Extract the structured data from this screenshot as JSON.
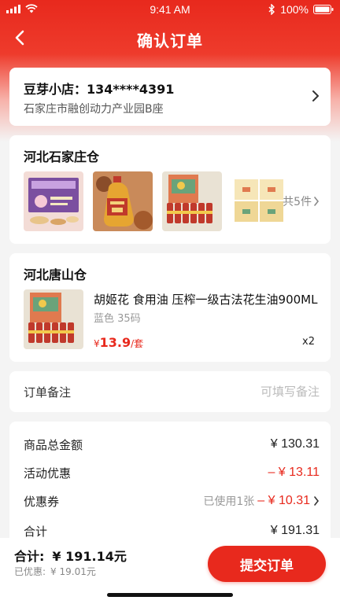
{
  "status_bar": {
    "time": "9:41 AM",
    "battery": "100%"
  },
  "nav": {
    "title": "确认订单"
  },
  "address": {
    "name_phone": "豆芽小店：134****4391",
    "detail": "石家庄市融创动力产业园B座"
  },
  "warehouse1": {
    "title": "河北石家庄仓",
    "thumbnails": [
      "gift-box",
      "peanut-oil-bottle",
      "drink-gift-pack",
      "tissue-pack"
    ],
    "more": "共5件"
  },
  "warehouse2": {
    "title": "河北唐山仓",
    "product": {
      "name": "胡姬花 食用油 压榨一级古法花生油900ML",
      "spec": "蓝色 35码",
      "price_currency": "¥",
      "price": "13.9",
      "price_unit": "/套",
      "qty": "x2"
    }
  },
  "remark": {
    "label": "订单备注",
    "placeholder": "可填写备注"
  },
  "summary": {
    "goods_total_label": "商品总金额",
    "goods_total": "¥ 130.31",
    "promo_label": "活动优惠",
    "promo": "– ¥ 13.11",
    "coupon_label": "优惠券",
    "coupon_used": "已使用1张",
    "coupon": "– ¥ 10.31",
    "subtotal_label": "合计",
    "subtotal": "¥ 191.31"
  },
  "bottom": {
    "total_label": "合计:",
    "total": "¥ 191.14元",
    "saved_label": "已优惠:",
    "saved": "¥ 19.01元",
    "submit": "提交订单"
  },
  "colors": {
    "accent": "#e8291d",
    "muted": "#999999",
    "background": "#f4f4f4"
  }
}
